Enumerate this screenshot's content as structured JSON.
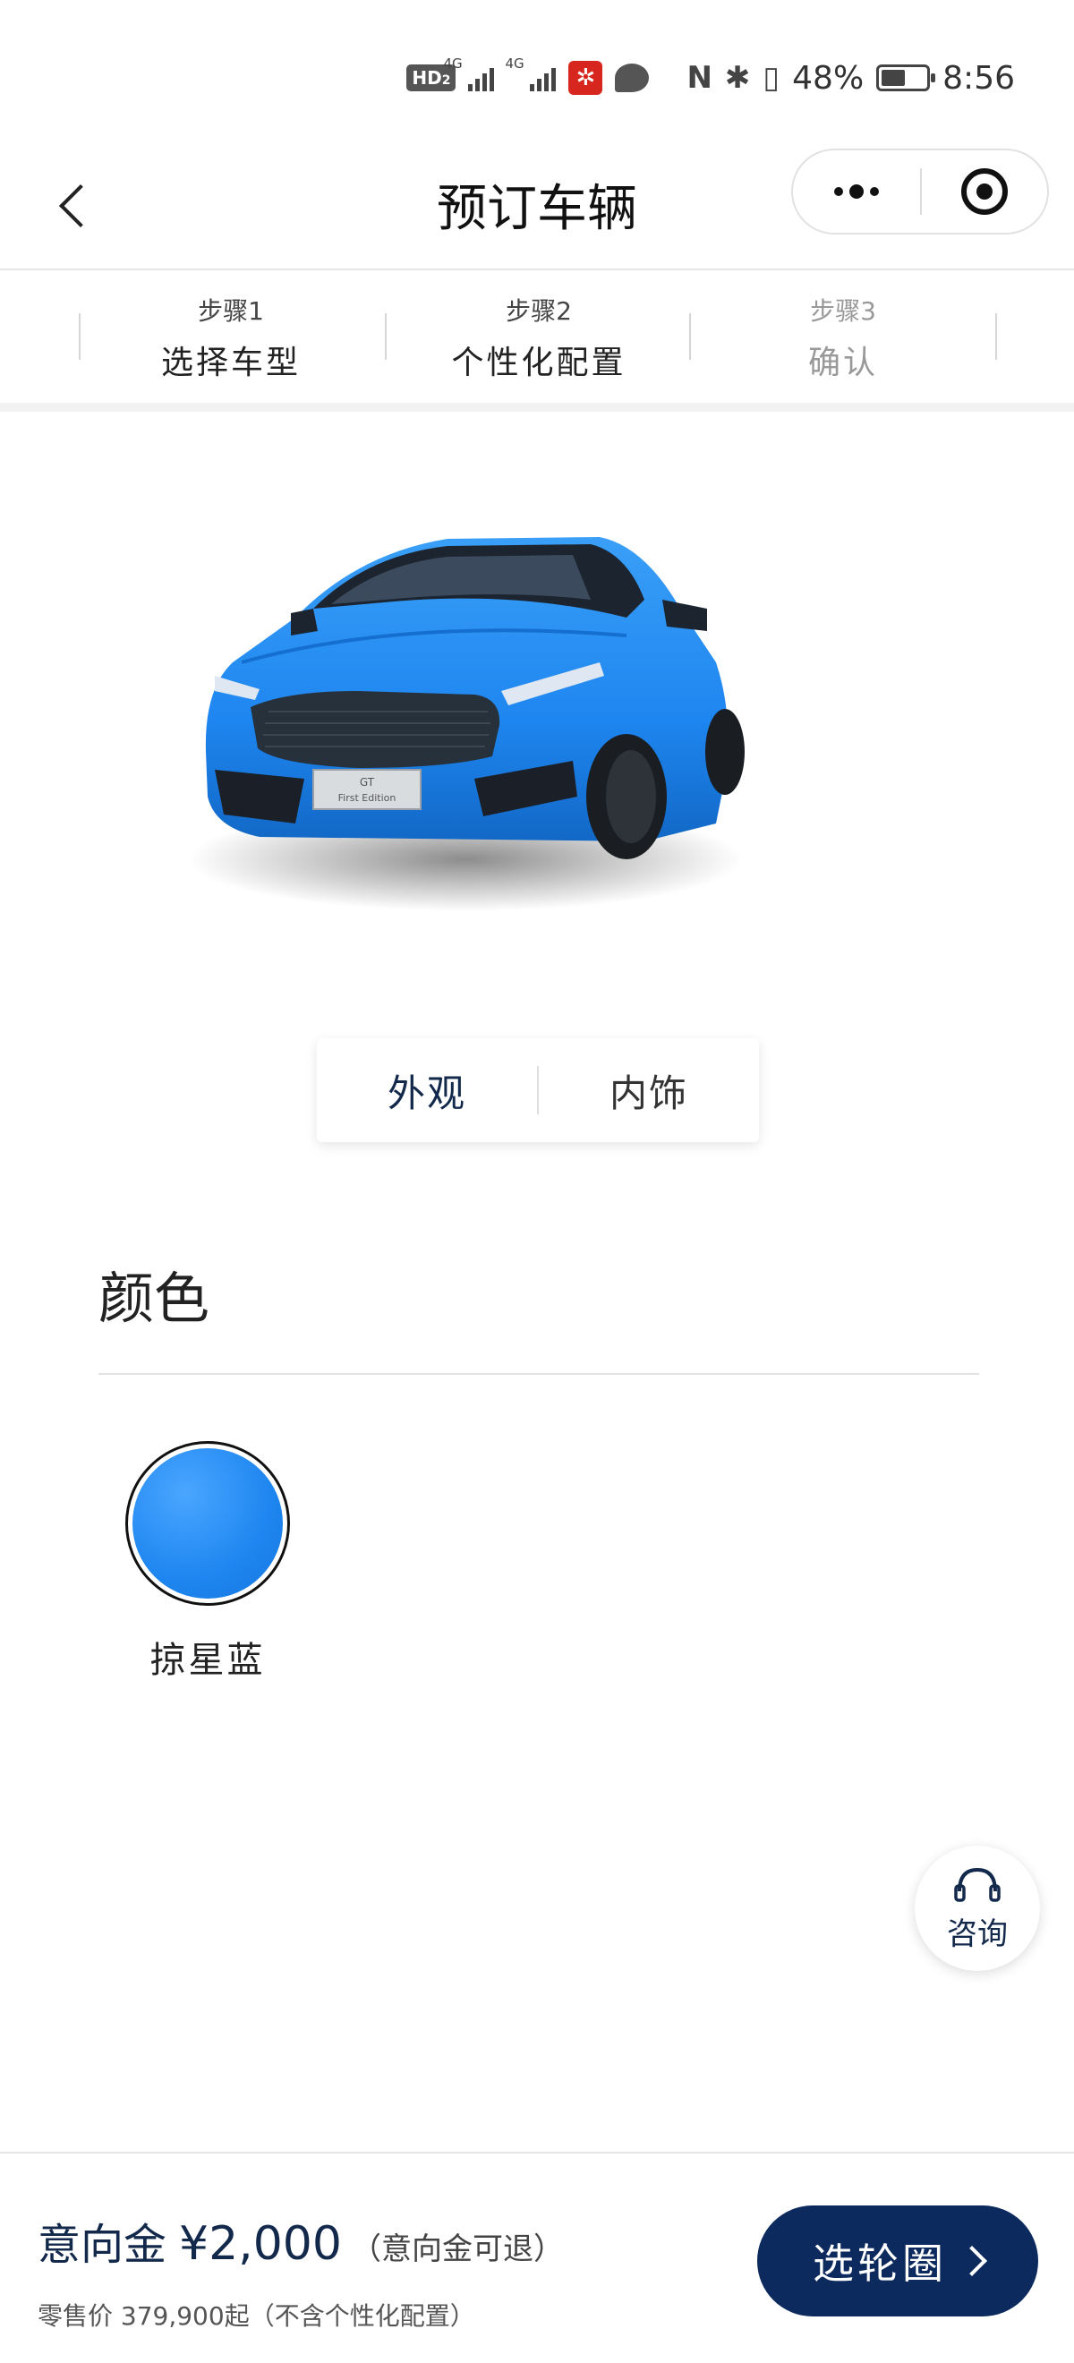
{
  "status_bar": {
    "hd": "HD",
    "hd_sub": "2",
    "sig1_label": "4G",
    "sig2_label": "4G",
    "battery": "48%",
    "time": "8:56"
  },
  "nav": {
    "title": "预订车辆"
  },
  "steps": [
    {
      "num": "步骤1",
      "label": "选择车型"
    },
    {
      "num": "步骤2",
      "label": "个性化配置"
    },
    {
      "num": "步骤3",
      "label": "确认"
    }
  ],
  "car": {
    "plate_line1": "GT",
    "plate_line2": "First Edition",
    "body_color": "#1e86f0"
  },
  "view_toggle": {
    "exterior": "外观",
    "interior": "内饰"
  },
  "color_section": {
    "title": "颜色",
    "swatches": [
      {
        "name": "掠星蓝",
        "color": "#1e86f0"
      }
    ]
  },
  "consult": {
    "label": "咨询",
    "icon": "headset-icon"
  },
  "bottom": {
    "deposit_label": "意向金",
    "deposit_amount": "¥2,000",
    "deposit_note": "（意向金可退）",
    "retail_price": "零售价 379,900起（不含个性化配置）",
    "cta_label": "选轮圈"
  },
  "colors": {
    "brand_navy": "#13294b",
    "cta_bg": "#0c2a5e"
  }
}
